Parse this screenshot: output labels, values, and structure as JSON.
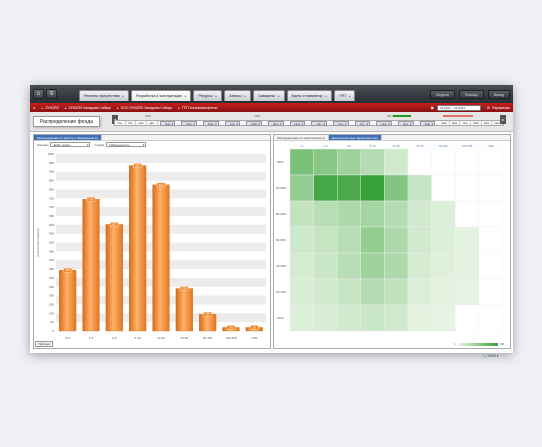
{
  "topbar": {
    "tabs": [
      {
        "label": "Регионы присутствия",
        "active": false
      },
      {
        "label": "Разработка и эксплуатация",
        "active": true
      },
      {
        "label": "Ресурсы",
        "active": false
      },
      {
        "label": "Запасы",
        "active": false
      },
      {
        "label": "Скважины",
        "active": false
      },
      {
        "label": "Карты и навигатор",
        "active": false
      },
      {
        "label": "ГРП",
        "active": false
      }
    ],
    "right_buttons": [
      "Модели",
      "Помощь",
      "Выход"
    ]
  },
  "breadcrumb": {
    "items": [
      "ЛУКОЙЛ",
      "ЛУКОЙЛ-Западная Сибирь",
      "ООО ЛУКОЙЛ-Западная Сибирь",
      "ТПП Когалымнефтегаз"
    ],
    "period": "01.2013 – 01.2014",
    "params_label": "Параметры"
  },
  "toolbar": {
    "page_title": "Распределение фонда",
    "years": [
      "2012",
      "2013",
      "2014"
    ],
    "months": [
      "Сен",
      "Окт",
      "Ноя",
      "Дек",
      "Янв",
      "Фев",
      "Мар",
      "Апр",
      "Май",
      "Июн",
      "Июл",
      "Авг",
      "Сен",
      "Окт",
      "Ноя",
      "Дек",
      "Янв",
      "Фев",
      "Мар",
      "Апр",
      "Май",
      "Июн",
      "Июл"
    ]
  },
  "left_panel": {
    "tabs": [
      "Распределение по дебиту и обводненности"
    ],
    "filters": {
      "columns_label": "Колонки",
      "columns_value": "Дебит нефти",
      "rows_label": "Строки",
      "rows_value": "Обводненность"
    },
    "table_button": "Таблица"
  },
  "right_panel": {
    "tabs": [
      "Распределение по накопленности",
      "Дополнительные характеристики"
    ]
  },
  "chart_data": [
    {
      "type": "bar",
      "categories": [
        "<0-1",
        "1-3",
        "3-5",
        "5-10",
        "10-20",
        "20-50",
        "50-100",
        "100-200",
        ">200"
      ],
      "values": [
        344,
        744,
        602,
        935,
        826,
        240,
        95,
        20,
        20
      ],
      "ylim": [
        0,
        1000
      ],
      "yticks": [
        0,
        50,
        100,
        150,
        200,
        250,
        300,
        350,
        400,
        450,
        500,
        550,
        600,
        650,
        700,
        750,
        800,
        850,
        900,
        950,
        1000
      ],
      "ylabel": "Количество скважин",
      "color": "#f08a2c"
    },
    {
      "type": "heatmap",
      "x_labels": [
        "<1",
        "1-3",
        "3-5",
        "5-10",
        "10-20",
        "20-50",
        "50-100",
        "100-200",
        ">200"
      ],
      "y_labels": [
        ">95%",
        "90-95%",
        "80-90%",
        "60-80%",
        "40-60%",
        "20-40%",
        "<20%"
      ],
      "values": [
        [
          62,
          55,
          42,
          30,
          14,
          0,
          0,
          0,
          0
        ],
        [
          48,
          92,
          88,
          100,
          58,
          20,
          0,
          0,
          0
        ],
        [
          22,
          28,
          34,
          38,
          30,
          14,
          8,
          0,
          0
        ],
        [
          16,
          20,
          28,
          48,
          34,
          14,
          8,
          4,
          0
        ],
        [
          12,
          18,
          28,
          42,
          34,
          12,
          6,
          4,
          0
        ],
        [
          10,
          14,
          20,
          30,
          24,
          8,
          4,
          2,
          0
        ],
        [
          8,
          10,
          14,
          18,
          14,
          4,
          2,
          0,
          0
        ]
      ],
      "legend_min": "1",
      "legend_max": "≥80",
      "colors": {
        "low": "#eaf6e6",
        "high": "#37a037"
      }
    }
  ],
  "status": {
    "zoom": "100%"
  }
}
